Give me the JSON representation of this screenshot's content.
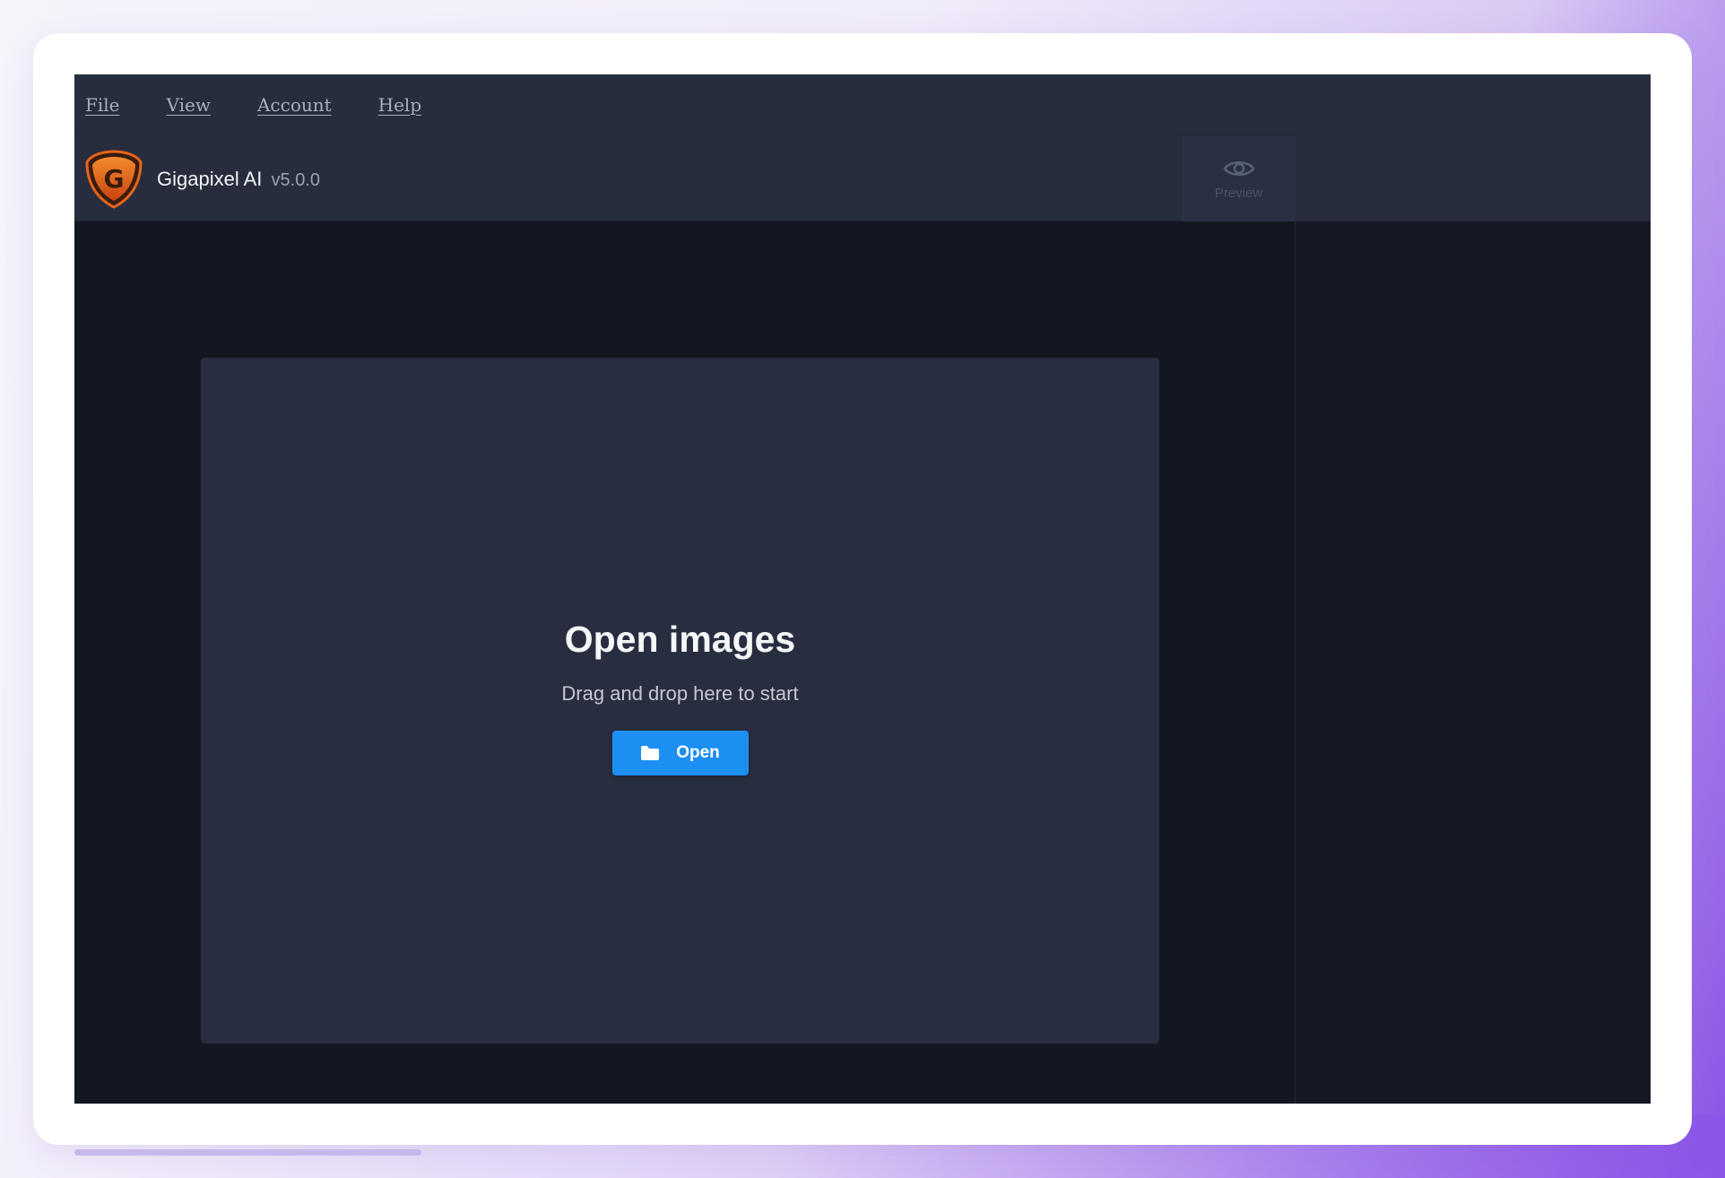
{
  "menubar": {
    "items": [
      {
        "label": "File"
      },
      {
        "label": "View"
      },
      {
        "label": "Account"
      },
      {
        "label": "Help"
      }
    ]
  },
  "header": {
    "logo_letter": "G",
    "app_name": "Gigapixel AI",
    "version": "v5.0.0",
    "preview_label": "Preview",
    "preview_icon": "eye-icon"
  },
  "drop_zone": {
    "title": "Open images",
    "subtitle": "Drag and drop here to start",
    "open_button_label": "Open",
    "open_button_icon": "folder-icon"
  },
  "colors": {
    "accent": "#1c8ff2",
    "logo_orange": "#e8651a",
    "app_background": "#131722",
    "panel_background": "#272d3d",
    "drop_zone_background": "#282e40"
  }
}
